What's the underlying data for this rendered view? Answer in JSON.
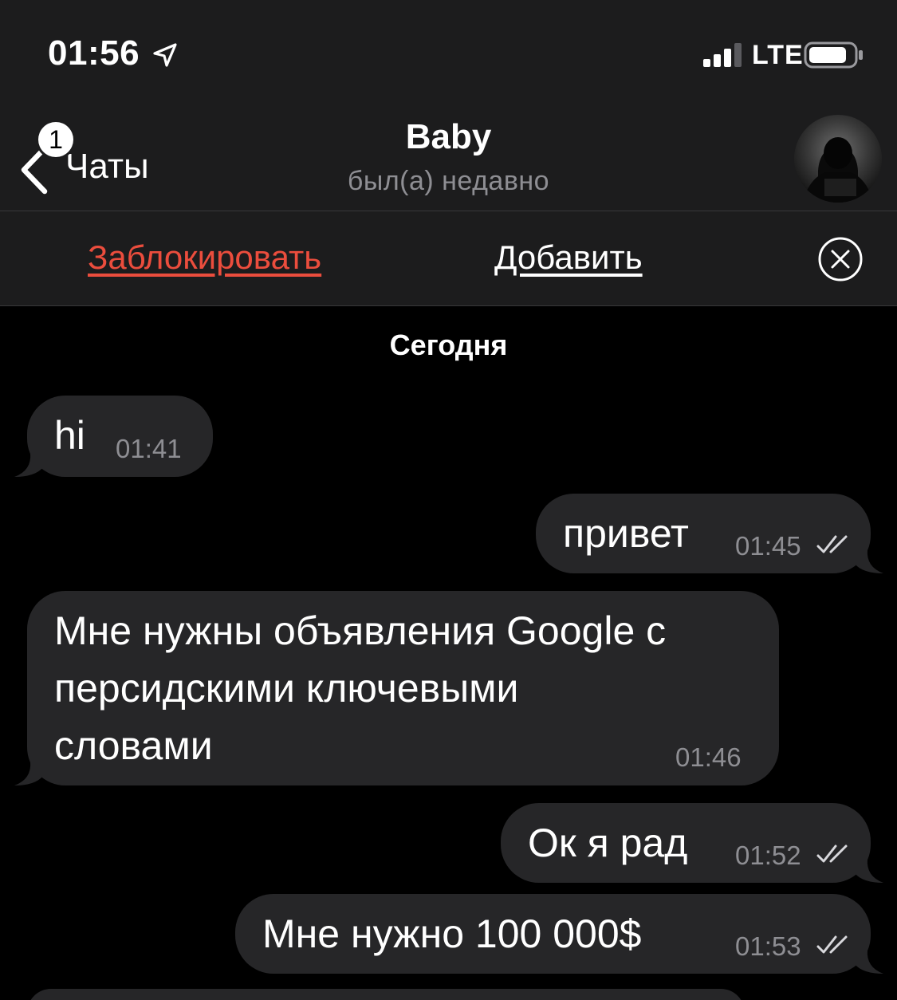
{
  "status_bar": {
    "time": "01:56",
    "network": "LTE",
    "icons": [
      "location-arrow-icon",
      "signal-icon",
      "battery-icon"
    ]
  },
  "nav": {
    "back_label": "Чаты",
    "unread_badge": "1",
    "title": "Baby",
    "subtitle": "был(а) недавно",
    "avatar": "hooded-figure-avatar"
  },
  "actions": {
    "block_label": "Заблокировать",
    "add_label": "Добавить",
    "close_icon": "close-circle-icon"
  },
  "chat": {
    "date_separator": "Сегодня",
    "messages": [
      {
        "direction": "incoming",
        "text": "hi",
        "time": "01:41",
        "read": false
      },
      {
        "direction": "outgoing",
        "text": "привет",
        "time": "01:45",
        "read": true
      },
      {
        "direction": "incoming",
        "text": "Мне нужны объявления Google с\nперсидскими ключевыми\nсловами",
        "time": "01:46",
        "read": false
      },
      {
        "direction": "outgoing",
        "text": "Ок я рад",
        "time": "01:52",
        "read": true
      },
      {
        "direction": "outgoing",
        "text": "Мне нужно 100 000$",
        "time": "01:53",
        "read": true
      }
    ]
  },
  "colors": {
    "background": "#000000",
    "bar_background": "#1c1c1d",
    "bubble": "#262628",
    "block_red": "#eb4d3d",
    "secondary_text": "#8e8e93"
  }
}
